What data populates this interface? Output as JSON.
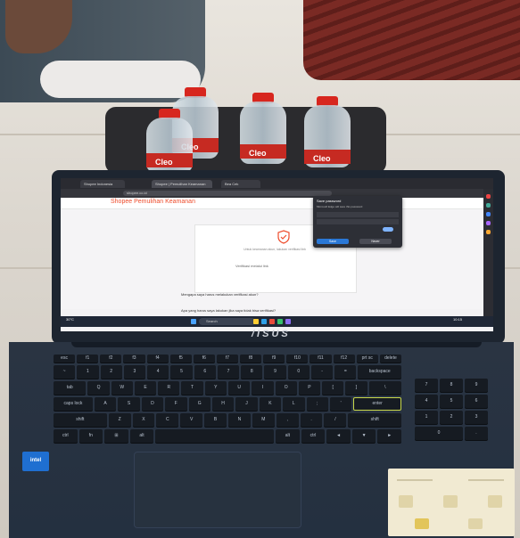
{
  "scene": {
    "bottle_label": "Cleo",
    "laptop_brand": "/ISUS",
    "intel_badge": "intel"
  },
  "browser": {
    "tabs": [
      "Shopee Indonesia",
      "Shopee | Pemulihan Keamanan",
      "Bea Cek"
    ],
    "address": "shopee.co.id",
    "page_title": "Shopee Pemulihan Keamanan",
    "card_text": "Untuk keamanan akun, lakukan verifikasi link",
    "verify_link": "Verifikasi melalui link",
    "faq": [
      "Mengapa saya harus melakukan verifikasi akun?",
      "Apa yang harus saya lakukan jika saya tidak bisa verifikasi?"
    ]
  },
  "popup": {
    "title": "Save password",
    "subtitle": "Microsoft Edge will save this password",
    "primary": "Save",
    "secondary": "Never"
  },
  "taskbar": {
    "weather": "30°C",
    "search": "Search",
    "clock": "10:15"
  },
  "keyboard": {
    "rows": [
      [
        "esc",
        "f1",
        "f2",
        "f3",
        "f4",
        "f5",
        "f6",
        "f7",
        "f8",
        "f9",
        "f10",
        "f11",
        "f12",
        "prt sc",
        "delete"
      ],
      [
        "~",
        "1",
        "2",
        "3",
        "4",
        "5",
        "6",
        "7",
        "8",
        "9",
        "0",
        "-",
        "=",
        "backspace"
      ],
      [
        "tab",
        "Q",
        "W",
        "E",
        "R",
        "T",
        "Y",
        "U",
        "I",
        "O",
        "P",
        "[",
        "]",
        "\\"
      ],
      [
        "caps lock",
        "A",
        "S",
        "D",
        "F",
        "G",
        "H",
        "J",
        "K",
        "L",
        ";",
        "'",
        "enter"
      ],
      [
        "shift",
        "Z",
        "X",
        "C",
        "V",
        "B",
        "N",
        "M",
        ",",
        ".",
        "/",
        "shift"
      ],
      [
        "ctrl",
        "fn",
        "⊞",
        "alt",
        "",
        "alt",
        "ctrl",
        "◄",
        "▼",
        "►"
      ]
    ],
    "numpad": [
      "7",
      "8",
      "9",
      "4",
      "5",
      "6",
      "1",
      "2",
      "3",
      "0",
      "."
    ]
  }
}
